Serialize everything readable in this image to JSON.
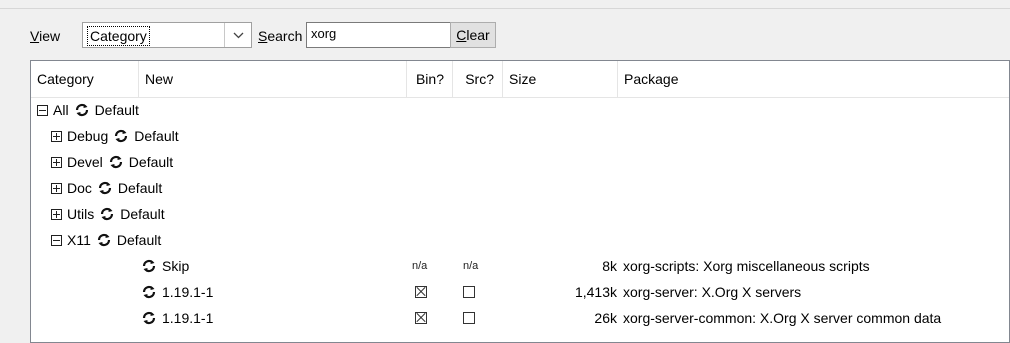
{
  "toolbar": {
    "view_label_first": "V",
    "view_label_rest": "iew",
    "view_value": "Category",
    "search_label_first": "S",
    "search_label_rest": "earch",
    "search_value": "xorg",
    "clear_first": "C",
    "clear_rest": "lear"
  },
  "columns": {
    "category": "Category",
    "new": "New",
    "bin": "Bin?",
    "src": "Src?",
    "size": "Size",
    "package": "Package"
  },
  "tree": [
    {
      "name": "All",
      "state": "Default",
      "expanded": true
    },
    {
      "name": "Debug",
      "state": "Default",
      "expanded": false
    },
    {
      "name": "Devel",
      "state": "Default",
      "expanded": false
    },
    {
      "name": "Doc",
      "state": "Default",
      "expanded": false
    },
    {
      "name": "Utils",
      "state": "Default",
      "expanded": false
    },
    {
      "name": "X11",
      "state": "Default",
      "expanded": true
    }
  ],
  "packages": [
    {
      "new": "Skip",
      "bin": "n/a",
      "src": "n/a",
      "bin_checked": false,
      "src_checked": false,
      "size": "8k",
      "package": "xorg-scripts: Xorg miscellaneous scripts"
    },
    {
      "new": "1.19.1-1",
      "bin": "",
      "src": "",
      "bin_checked": true,
      "src_checked": false,
      "size": "1,413k",
      "package": "xorg-server: X.Org X servers"
    },
    {
      "new": "1.19.1-1",
      "bin": "",
      "src": "",
      "bin_checked": true,
      "src_checked": false,
      "size": "26k",
      "package": "xorg-server-common: X.Org X server common data"
    }
  ]
}
